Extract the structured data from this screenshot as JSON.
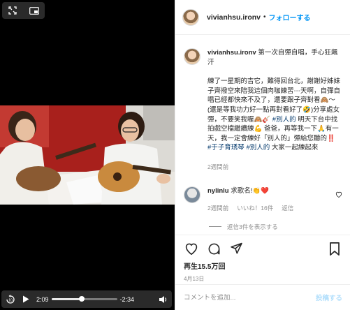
{
  "video": {
    "elapsed": "2:09",
    "remaining": "-2:34",
    "progress": 0.46
  },
  "post": {
    "username": "vivianhsu.ironv",
    "separator": "•",
    "follow_label": "フォローする",
    "caption_title": "第一次自彈自唱，手心狂飆汗",
    "caption_body": "練了一星期的吉它，難得回台北，謝謝好姊妹子齊撥空來陪我這個肉咖練習⋯天啊，自彈自唱已經都快來不及了，還要跟子齊對看🙈～(還是等我功力好一點再對看好了🤣)分享處女彈，不要笑我喔🙈🎸 ",
    "caption_hashtag1": "#別人的",
    "caption_body2": " 明天下台中找拍戲空檔繼續練💪 爸爸，再等我一下🙏有一天，我一定會練好「別人的」彈給您聽的‼️ ",
    "caption_hashtag2": "#于子育琇琴",
    "caption_hashtag3": "#別人的",
    "caption_end": " 大家一起練起來",
    "caption_time": "2週間前",
    "views": "再生15.5万回",
    "date": "4月13日"
  },
  "comment": {
    "username": "nylinlu",
    "text": "求歌名!👏❤️",
    "time": "2週間前",
    "likes": "いいね！16件",
    "reply_label": "返信",
    "view_replies": "返信3件を表示する"
  },
  "add_comment": {
    "placeholder": "コメントを追加...",
    "post_label": "投稿する"
  },
  "colors": {
    "accent": "#0095f6",
    "hashtag": "#00376b",
    "muted": "#8e8e8e",
    "heart_red": "#ed4956"
  },
  "icons": [
    "expand-icon",
    "picture-in-picture-icon",
    "replay-10-icon",
    "play-icon",
    "volume-icon",
    "heart-icon",
    "comment-icon",
    "share-icon",
    "bookmark-icon"
  ]
}
